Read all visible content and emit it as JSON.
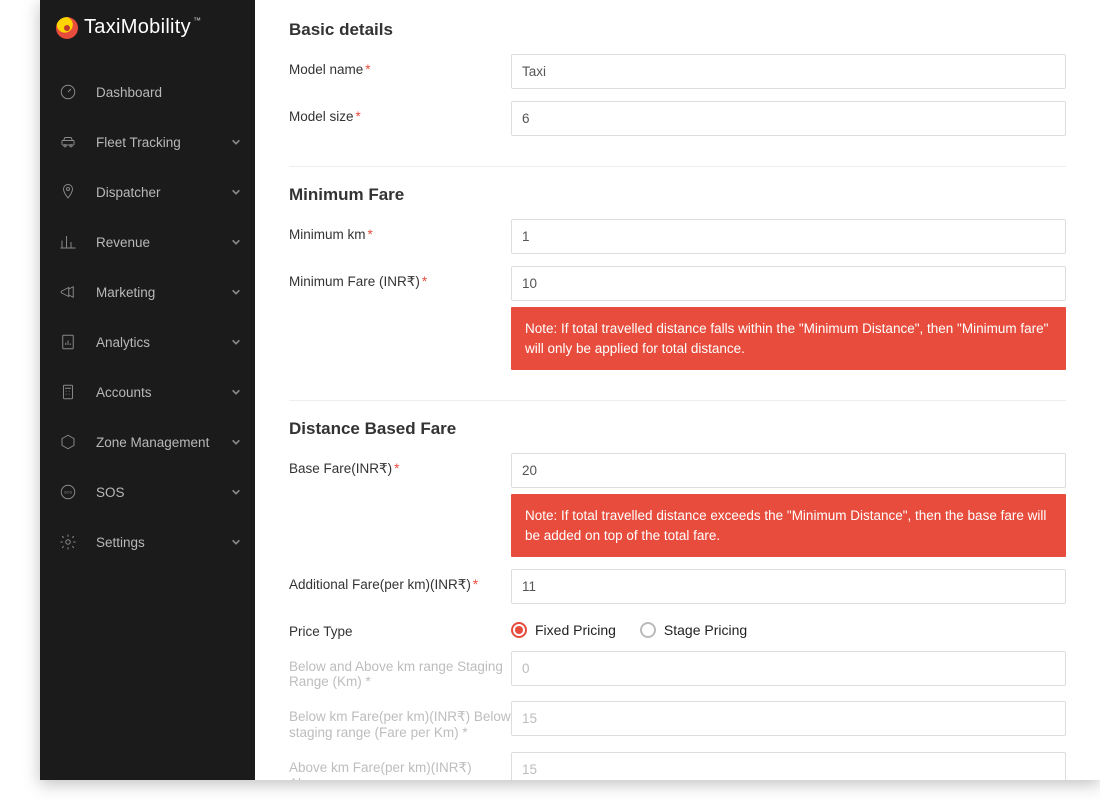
{
  "brand": {
    "name": "TaxiMobility",
    "tm": "™"
  },
  "sidebar": {
    "items": [
      {
        "label": "Dashboard",
        "expandable": false
      },
      {
        "label": "Fleet Tracking",
        "expandable": true
      },
      {
        "label": "Dispatcher",
        "expandable": true
      },
      {
        "label": "Revenue",
        "expandable": true
      },
      {
        "label": "Marketing",
        "expandable": true
      },
      {
        "label": "Analytics",
        "expandable": true
      },
      {
        "label": "Accounts",
        "expandable": true
      },
      {
        "label": "Zone Management",
        "expandable": true
      },
      {
        "label": "SOS",
        "expandable": true
      },
      {
        "label": "Settings",
        "expandable": true
      }
    ]
  },
  "sections": {
    "basic": {
      "title": "Basic details",
      "model_name_label": "Model name",
      "model_name_value": "Taxi",
      "model_size_label": "Model size",
      "model_size_value": "6"
    },
    "minfare": {
      "title": "Minimum Fare",
      "min_km_label": "Minimum km",
      "min_km_value": "1",
      "min_fare_label": "Minimum Fare (INR₹)",
      "min_fare_value": "10",
      "note": "Note: If total travelled distance falls within the \"Minimum Distance\", then \"Minimum fare\" will only be applied for total distance."
    },
    "distfare": {
      "title": "Distance Based Fare",
      "base_fare_label": "Base Fare(INR₹)",
      "base_fare_value": "20",
      "note": "Note: If total travelled distance exceeds the \"Minimum Distance\", then the base fare will be added on top of the total fare.",
      "addl_fare_label": "Additional Fare(per km)(INR₹)",
      "addl_fare_value": "11",
      "price_type_label": "Price Type",
      "price_type_options": {
        "fixed": "Fixed Pricing",
        "stage": "Stage Pricing"
      },
      "price_type_selected": "fixed",
      "staging_range_label": "Below and Above km range Staging Range (Km) *",
      "staging_range_value": "0",
      "below_km_label": "Below km Fare(per km)(INR₹) Below staging range (Fare per Km) *",
      "below_km_value": "15",
      "above_km_label": "Above km Fare(per km)(INR₹) Above",
      "above_km_value": "15"
    }
  }
}
